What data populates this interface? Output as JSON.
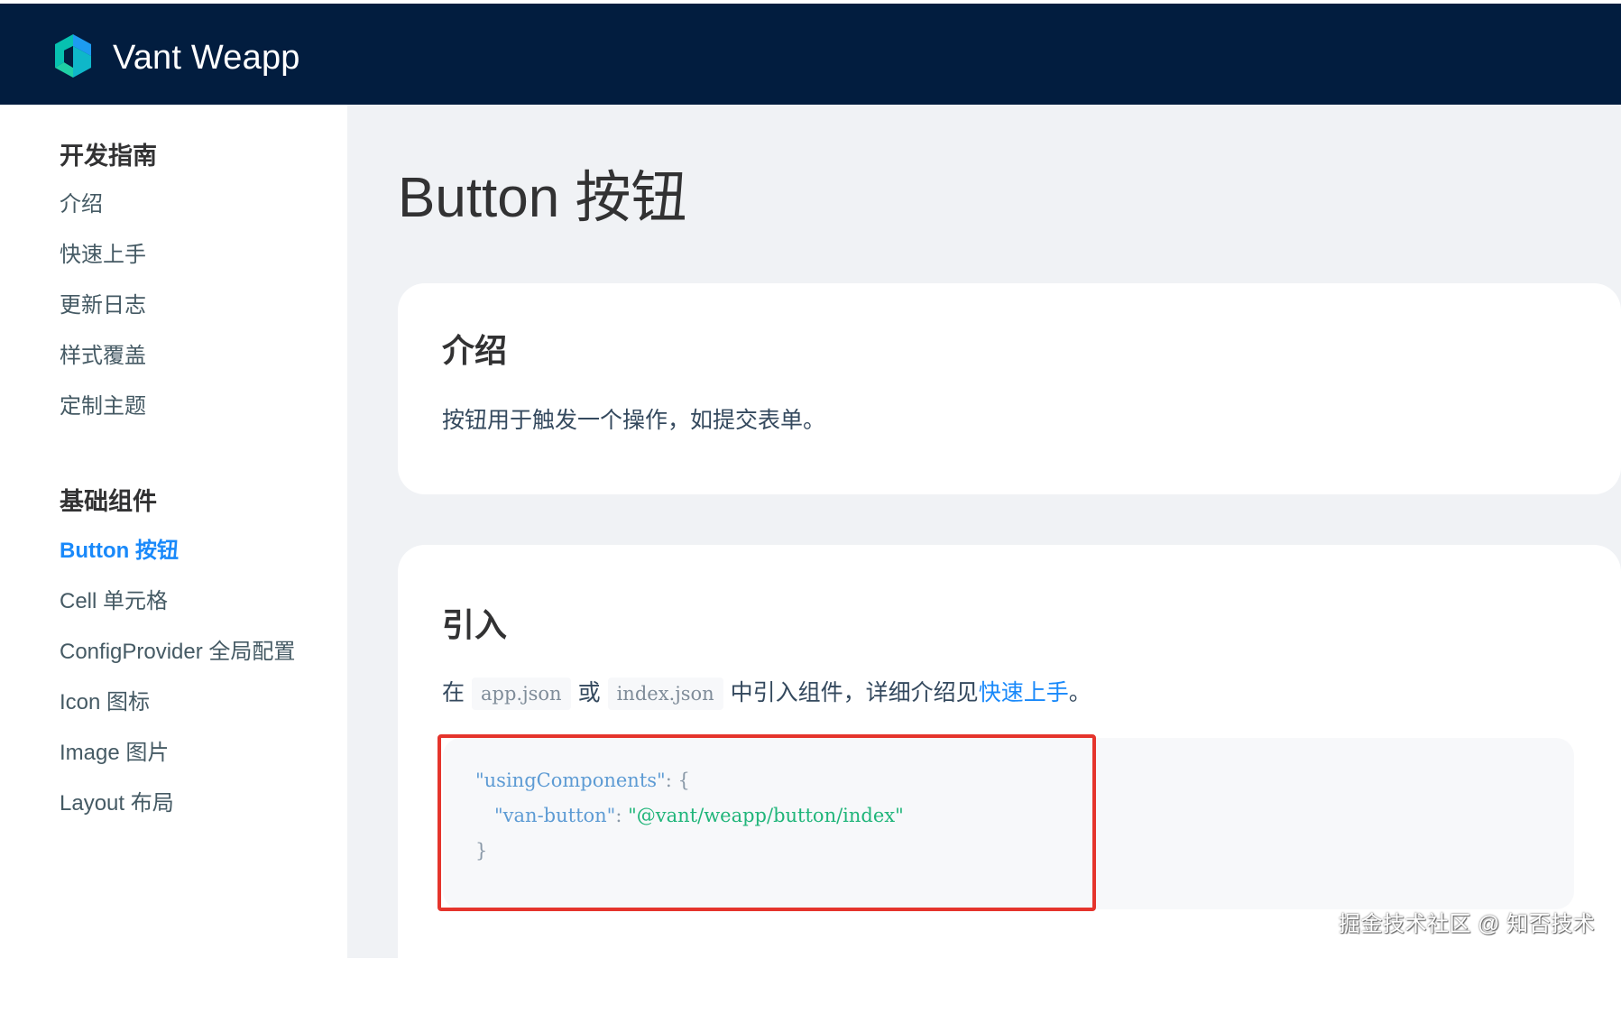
{
  "header": {
    "brand": "Vant Weapp",
    "bg_color": "#021d3f"
  },
  "sidebar": {
    "groups": [
      {
        "title": "开发指南",
        "items": [
          "介绍",
          "快速上手",
          "更新日志",
          "样式覆盖",
          "定制主题"
        ]
      },
      {
        "title": "基础组件",
        "items": [
          "Button 按钮",
          "Cell 单元格",
          "ConfigProvider 全局配置",
          "Icon 图标",
          "Image 图片",
          "Layout 布局"
        ]
      }
    ],
    "active_item": "Button 按钮",
    "active_color": "#1989fa"
  },
  "main": {
    "title": "Button 按钮",
    "sections": [
      {
        "heading": "介绍",
        "text": "按钮用于触发一个操作，如提交表单。"
      },
      {
        "heading": "引入",
        "intro_prefix": "在",
        "code_1": "app.json",
        "intro_or": "或",
        "code_2": "index.json",
        "intro_mid": "中引入组件，详细介绍见",
        "link": "快速上手",
        "intro_suffix": "。",
        "code": {
          "line1_key": "\"usingComponents\"",
          "line1_rest": ": {",
          "line2_key": "\"van-button\"",
          "line2_colon": ": ",
          "line2_value": "\"@vant/weapp/button/index\"",
          "line3": "}"
        }
      }
    ]
  },
  "annotation": {
    "highlight_color": "#e5342c"
  },
  "watermark": "掘金技术社区 @ 知否技术"
}
